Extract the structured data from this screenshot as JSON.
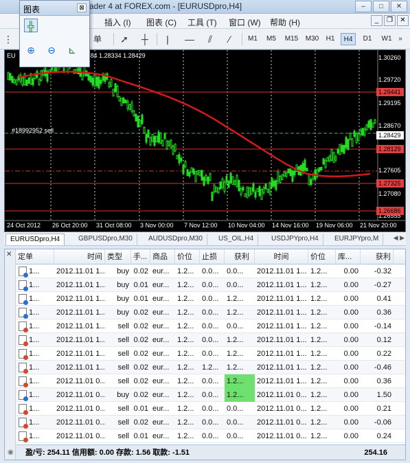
{
  "window": {
    "title": "ader 4 at FOREX.com - [EURUSDpro,H4]"
  },
  "menu": [
    "插入 (I)",
    "图表 (C)",
    "工具 (T)",
    "窗口 (W)",
    "帮助 (H)"
  ],
  "floating_panel": {
    "title": "图表"
  },
  "toolbar": {
    "partial_label": "单",
    "timeframes": [
      "M1",
      "M5",
      "M15",
      "M30",
      "H1",
      "H4",
      "D1",
      "W1"
    ],
    "active_timeframe": "H4"
  },
  "chart": {
    "header_prefix": "EU",
    "header_text": "28484 1.28334 1.28429",
    "order_label": "#18992952 sell",
    "price_scale": [
      "1.30260",
      "1.29720",
      "1.29195",
      "1.28670",
      "1.27605",
      "1.27080",
      "1.26555"
    ],
    "price_tags": [
      {
        "value": "1.29441",
        "color": "#e04040"
      },
      {
        "value": "1.28429",
        "color": "#ffffff"
      },
      {
        "value": "1.28129",
        "color": "#e04040"
      },
      {
        "value": "1.27325",
        "color": "#e04040"
      },
      {
        "value": "1.26686",
        "color": "#e04040"
      }
    ],
    "dates": [
      "24 Oct 2012",
      "26 Oct 20:00",
      "31 Oct 08:00",
      "3 Nov 00:00",
      "7 Nov 12:00",
      "10 Nov 04:00",
      "14 Nov 16:00",
      "19 Nov 06:00",
      "21 Nov 20:00"
    ]
  },
  "chart_tabs": [
    "EURUSDpro,H4",
    "GBPUSDpro,M30",
    "AUDUSDpro,M30",
    "US_OIL,H4",
    "USDJPYpro,H4",
    "EURJPYpro,M"
  ],
  "terminal": {
    "columns": [
      "定单",
      "时间",
      "类型",
      "手...",
      "商品",
      "价位",
      "止损",
      "获利",
      "时间",
      "价位",
      "库...",
      "获利"
    ],
    "rows": [
      {
        "icon": "blue",
        "id": "1...",
        "open_time": "2012.11.01 1...",
        "type": "buy",
        "lots": "0.02",
        "symbol": "eur...",
        "price": "1.2...",
        "sl": "0.0...",
        "tp": "0.0...",
        "close_time": "2012.11.01 1...",
        "close_price": "1.2...",
        "swap": "0.00",
        "profit": "-0.32",
        "tp_hl": false
      },
      {
        "icon": "blue",
        "id": "1...",
        "open_time": "2012.11.01 1...",
        "type": "buy",
        "lots": "0.01",
        "symbol": "eur...",
        "price": "1.2...",
        "sl": "0.0...",
        "tp": "0.0...",
        "close_time": "2012.11.01 1...",
        "close_price": "1.2...",
        "swap": "0.00",
        "profit": "-0.27",
        "tp_hl": false
      },
      {
        "icon": "blue",
        "id": "1...",
        "open_time": "2012.11.01 1...",
        "type": "buy",
        "lots": "0.01",
        "symbol": "eur...",
        "price": "1.2...",
        "sl": "0.0...",
        "tp": "1.2...",
        "close_time": "2012.11.01 1...",
        "close_price": "1.2...",
        "swap": "0.00",
        "profit": "0.41",
        "tp_hl": false
      },
      {
        "icon": "blue",
        "id": "1...",
        "open_time": "2012.11.01 1...",
        "type": "buy",
        "lots": "0.02",
        "symbol": "eur...",
        "price": "1.2...",
        "sl": "0.0...",
        "tp": "1.2...",
        "close_time": "2012.11.01 1...",
        "close_price": "1.2...",
        "swap": "0.00",
        "profit": "0.36",
        "tp_hl": false
      },
      {
        "icon": "red",
        "id": "1...",
        "open_time": "2012.11.01 1...",
        "type": "sell",
        "lots": "0.02",
        "symbol": "eur...",
        "price": "1.2...",
        "sl": "0.0...",
        "tp": "0.0...",
        "close_time": "2012.11.01 1...",
        "close_price": "1.2...",
        "swap": "0.00",
        "profit": "-0.14",
        "tp_hl": false
      },
      {
        "icon": "red",
        "id": "1...",
        "open_time": "2012.11.01 1...",
        "type": "sell",
        "lots": "0.02",
        "symbol": "eur...",
        "price": "1.2...",
        "sl": "0.0...",
        "tp": "1.2...",
        "close_time": "2012.11.01 1...",
        "close_price": "1.2...",
        "swap": "0.00",
        "profit": "0.12",
        "tp_hl": false
      },
      {
        "icon": "red",
        "id": "1...",
        "open_time": "2012.11.01 1...",
        "type": "sell",
        "lots": "0.02",
        "symbol": "eur...",
        "price": "1.2...",
        "sl": "0.0...",
        "tp": "1.2...",
        "close_time": "2012.11.01 1...",
        "close_price": "1.2...",
        "swap": "0.00",
        "profit": "0.22",
        "tp_hl": false
      },
      {
        "icon": "red",
        "id": "1...",
        "open_time": "2012.11.01 1...",
        "type": "sell",
        "lots": "0.02",
        "symbol": "eur...",
        "price": "1.2...",
        "sl": "1.2...",
        "tp": "1.2...",
        "close_time": "2012.11.01 1...",
        "close_price": "1.2...",
        "swap": "0.00",
        "profit": "-0.46",
        "tp_hl": false
      },
      {
        "icon": "red",
        "id": "1...",
        "open_time": "2012.11.01 0...",
        "type": "sell",
        "lots": "0.02",
        "symbol": "eur...",
        "price": "1.2...",
        "sl": "0.0...",
        "tp": "1.2...",
        "close_time": "2012.11.01 1...",
        "close_price": "1.2...",
        "swap": "0.00",
        "profit": "0.36",
        "tp_hl": true
      },
      {
        "icon": "blue",
        "id": "1...",
        "open_time": "2012.11.01 0...",
        "type": "buy",
        "lots": "0.02",
        "symbol": "eur...",
        "price": "1.2...",
        "sl": "0.0...",
        "tp": "1.2...",
        "close_time": "2012.11.01 0...",
        "close_price": "1.2...",
        "swap": "0.00",
        "profit": "1.50",
        "tp_hl": true
      },
      {
        "icon": "red",
        "id": "1...",
        "open_time": "2012.11.01 0...",
        "type": "sell",
        "lots": "0.01",
        "symbol": "eur...",
        "price": "1.2...",
        "sl": "0.0...",
        "tp": "0.0...",
        "close_time": "2012.11.01 0...",
        "close_price": "1.2...",
        "swap": "0.00",
        "profit": "0.21",
        "tp_hl": false
      },
      {
        "icon": "red",
        "id": "1...",
        "open_time": "2012.11.01 0...",
        "type": "sell",
        "lots": "0.02",
        "symbol": "eur...",
        "price": "1.2...",
        "sl": "0.0...",
        "tp": "0.0...",
        "close_time": "2012.11.01 0...",
        "close_price": "1.2...",
        "swap": "0.00",
        "profit": "-0.06",
        "tp_hl": false
      },
      {
        "icon": "red",
        "id": "1...",
        "open_time": "2012.11.01 0...",
        "type": "sell",
        "lots": "0.01",
        "symbol": "eur...",
        "price": "1.2...",
        "sl": "0.0...",
        "tp": "0.0...",
        "close_time": "2012.11.01 0...",
        "close_price": "1.2...",
        "swap": "0.00",
        "profit": "0.24",
        "tp_hl": false
      }
    ],
    "footer": "盈/亏: 254.11  信用额: 0.00  存款: 1.56  取款: -1.51",
    "footer_total": "254.16"
  }
}
